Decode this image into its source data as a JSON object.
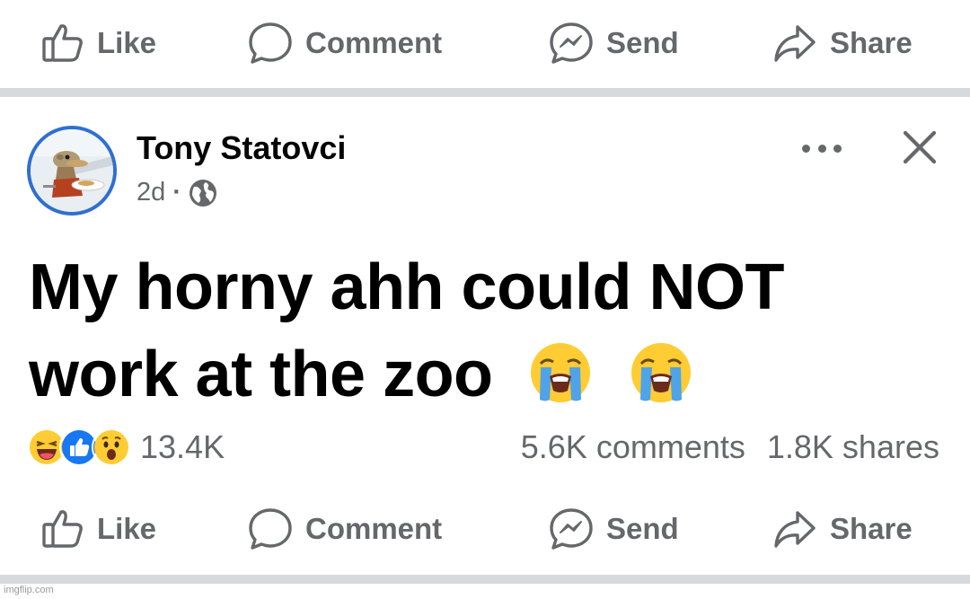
{
  "actions": {
    "like": "Like",
    "comment": "Comment",
    "send": "Send",
    "share": "Share"
  },
  "post": {
    "author": "Tony Statovci",
    "age": "2d",
    "separator": "·",
    "audience_icon": "globe-icon",
    "text_line1": "My horny ahh could NOT",
    "text_line2": "work at the zoo",
    "text_emojis": [
      "loudly-crying-face",
      "loudly-crying-face"
    ],
    "reactions": [
      "haha",
      "like",
      "wow"
    ],
    "reaction_count": "13.4K",
    "comments_count": "5.6K comments",
    "shares_count": "1.8K shares"
  },
  "watermark": "imgflip.com",
  "colors": {
    "muted_text": "#65676b",
    "divider": "#d8d9db",
    "avatar_ring": "#2f6fd1",
    "like_blue": "#1877f2",
    "emoji_yellow": "#ffcc33"
  }
}
